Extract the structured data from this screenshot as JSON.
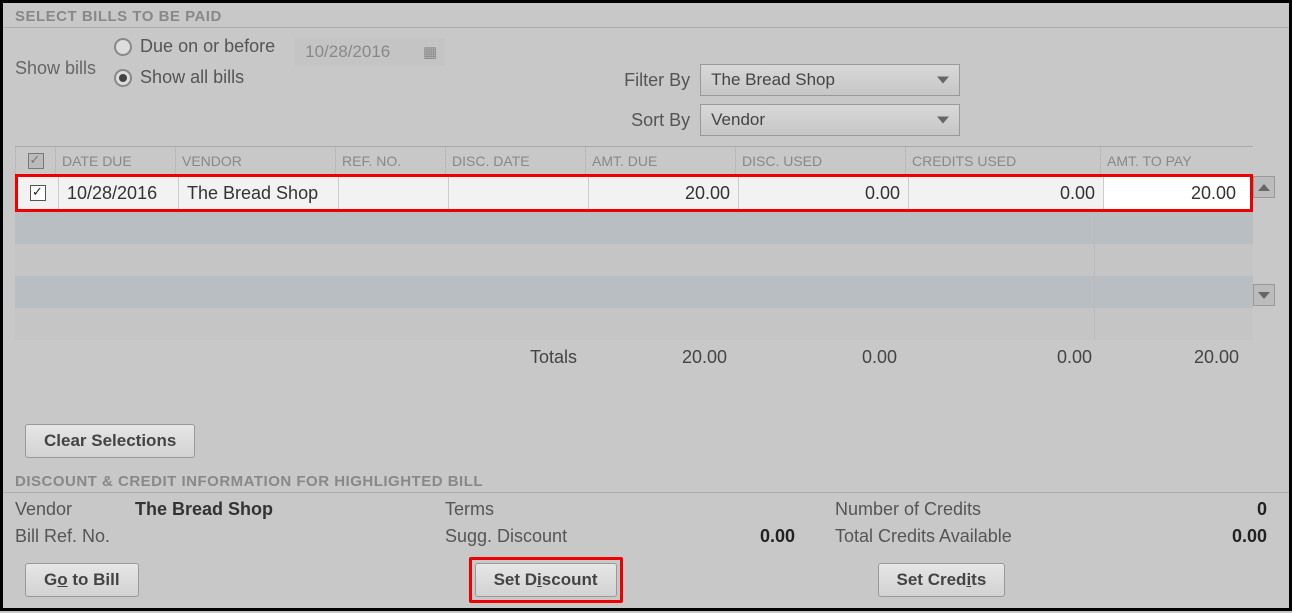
{
  "section_select": "SELECT BILLS TO BE PAID",
  "show_bills_label": "Show bills",
  "radio_due": "Due on or before",
  "radio_all": "Show all bills",
  "date_disabled": "10/28/2016",
  "filter_by_label": "Filter By",
  "sort_by_label": "Sort By",
  "filter_by_value": "The Bread Shop",
  "sort_by_value": "Vendor",
  "headers": {
    "date_due": "DATE DUE",
    "vendor": "VENDOR",
    "ref_no": "REF. NO.",
    "disc_date": "DISC. DATE",
    "amt_due": "AMT. DUE",
    "disc_used": "DISC. USED",
    "credits_used": "CREDITS USED",
    "amt_to_pay": "AMT. TO PAY"
  },
  "row": {
    "date_due": "10/28/2016",
    "vendor": "The Bread Shop",
    "ref_no": "",
    "disc_date": "",
    "amt_due": "20.00",
    "disc_used": "0.00",
    "credits_used": "0.00",
    "amt_to_pay": "20.00"
  },
  "totals_label": "Totals",
  "totals": {
    "amt_due": "20.00",
    "disc_used": "0.00",
    "credits_used": "0.00",
    "amt_to_pay": "20.00"
  },
  "clear_selections": "Clear Selections",
  "section_discount": "DISCOUNT & CREDIT INFORMATION FOR HIGHLIGHTED BILL",
  "info": {
    "vendor_label": "Vendor",
    "vendor_value": "The Bread Shop",
    "terms_label": "Terms",
    "terms_value": "",
    "num_credits_label": "Number of Credits",
    "num_credits_value": "0",
    "bill_ref_label": "Bill Ref. No.",
    "bill_ref_value": "",
    "sugg_disc_label": "Sugg. Discount",
    "sugg_disc_value": "0.00",
    "total_credits_label": "Total Credits Available",
    "total_credits_value": "0.00"
  },
  "buttons": {
    "go_to_bill_pre": "G",
    "go_to_bill_u": "o",
    "go_to_bill_post": " to Bill",
    "set_discount_pre": "Set D",
    "set_discount_u": "i",
    "set_discount_post": "scount",
    "set_credits_pre": "Set Cred",
    "set_credits_u": "i",
    "set_credits_post": "ts"
  }
}
